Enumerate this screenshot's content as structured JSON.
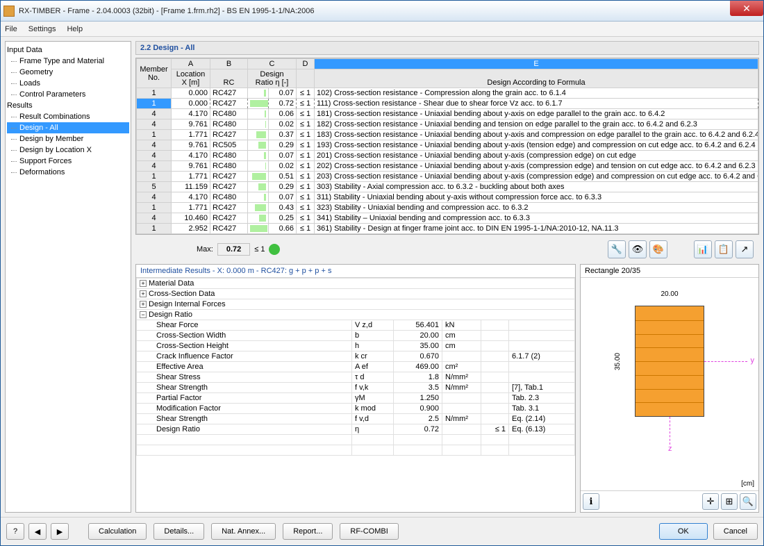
{
  "window": {
    "title": "RX-TIMBER - Frame - 2.04.0003 (32bit) - [Frame 1.frm.rh2] - BS EN 1995-1-1/NA:2006"
  },
  "menus": [
    "File",
    "Settings",
    "Help"
  ],
  "tree": {
    "input": "Input Data",
    "input_items": [
      "Frame Type and Material",
      "Geometry",
      "Loads",
      "Control Parameters"
    ],
    "results": "Results",
    "result_items": [
      "Result Combinations",
      "Design - All",
      "Design by Member",
      "Design by Location X",
      "Support Forces",
      "Deformations"
    ],
    "selected": "Design - All"
  },
  "section": "2.2 Design - All",
  "cols": {
    "letters": [
      "A",
      "B",
      "C",
      "D",
      "E"
    ],
    "member": "Member\nNo.",
    "loc": "Location\nX [m]",
    "rc": "RC",
    "design": "Design\nRatio η [-]",
    "acc": "Design According to Formula"
  },
  "rows": [
    {
      "m": "1",
      "x": "0.000",
      "rc": "RC427",
      "bar": 0.1,
      "r": "0.07",
      "c": "≤ 1",
      "d": "102) Cross-section resistance - Compression along the grain acc. to 6.1.4"
    },
    {
      "m": "1",
      "x": "0.000",
      "rc": "RC427",
      "bar": 0.95,
      "r": "0.72",
      "c": "≤ 1",
      "d": "111) Cross-section resistance - Shear due to shear force Vz acc. to 6.1.7",
      "sel": true
    },
    {
      "m": "4",
      "x": "4.170",
      "rc": "RC480",
      "bar": 0.08,
      "r": "0.06",
      "c": "≤ 1",
      "d": "181) Cross-section resistance - Uniaxial bending about y-axis on edge parallel to the grain acc. to 6.4.2"
    },
    {
      "m": "4",
      "x": "9.761",
      "rc": "RC480",
      "bar": 0.03,
      "r": "0.02",
      "c": "≤ 1",
      "d": "182) Cross-section resistance - Uniaxial bending and tension on edge parallel to the grain acc. to 6.4.2 and 6.2.3"
    },
    {
      "m": "1",
      "x": "1.771",
      "rc": "RC427",
      "bar": 0.5,
      "r": "0.37",
      "c": "≤ 1",
      "d": "183) Cross-section resistance - Uniaxial bending about y-axis and compression on edge parallel to the grain acc. to 6.4.2 and 6.2.4"
    },
    {
      "m": "4",
      "x": "9.761",
      "rc": "RC505",
      "bar": 0.4,
      "r": "0.29",
      "c": "≤ 1",
      "d": "193) Cross-section resistance - Uniaxial bending about y-axis (tension edge) and compression on cut edge acc. to 6.4.2 and 6.2.4"
    },
    {
      "m": "4",
      "x": "4.170",
      "rc": "RC480",
      "bar": 0.1,
      "r": "0.07",
      "c": "≤ 1",
      "d": "201) Cross-section resistance - Uniaxial bending about y-axis (compression edge) on cut edge"
    },
    {
      "m": "4",
      "x": "9.761",
      "rc": "RC480",
      "bar": 0.03,
      "r": "0.02",
      "c": "≤ 1",
      "d": "202) Cross-section resistance - Uniaxial bending about y-axis (compression edge) and tension on cut edge acc. to 6.4.2 and 6.2.3"
    },
    {
      "m": "1",
      "x": "1.771",
      "rc": "RC427",
      "bar": 0.7,
      "r": "0.51",
      "c": "≤ 1",
      "d": "203) Cross-section resistance - Uniaxial bending about y-axis (compression edge) and compression on cut edge acc. to 6.4.2 and 6."
    },
    {
      "m": "5",
      "x": "11.159",
      "rc": "RC427",
      "bar": 0.4,
      "r": "0.29",
      "c": "≤ 1",
      "d": "303) Stability - Axial compression acc. to 6.3.2 - buckling about both axes"
    },
    {
      "m": "4",
      "x": "4.170",
      "rc": "RC480",
      "bar": 0.1,
      "r": "0.07",
      "c": "≤ 1",
      "d": "311) Stability - Uniaxial bending about y-axis without compression force acc. to 6.3.3"
    },
    {
      "m": "1",
      "x": "1.771",
      "rc": "RC427",
      "bar": 0.58,
      "r": "0.43",
      "c": "≤ 1",
      "d": "323) Stability - Uniaxial bending and compression acc. to 6.3.2"
    },
    {
      "m": "4",
      "x": "10.460",
      "rc": "RC427",
      "bar": 0.34,
      "r": "0.25",
      "c": "≤ 1",
      "d": "341) Stability – Uniaxial bending and compression acc. to 6.3.3"
    },
    {
      "m": "1",
      "x": "2.952",
      "rc": "RC427",
      "bar": 0.88,
      "r": "0.66",
      "c": "≤ 1",
      "d": "361) Stability - Design at finger frame joint acc. to DIN EN 1995-1-1/NA:2010-12, NA.11.3"
    }
  ],
  "max": {
    "label": "Max:",
    "val": "0.72",
    "cond": "≤ 1"
  },
  "detail": {
    "title": "Intermediate Results  -  X: 0.000 m  -  RC427: g + p + p + s",
    "cats": [
      "Material Data",
      "Cross-Section Data",
      "Design Internal Forces",
      "Design Ratio"
    ],
    "rows": [
      {
        "n": "Shear Force",
        "s": "V z,d",
        "v": "56.401",
        "u": "kN",
        "cn": "",
        "ref": ""
      },
      {
        "n": "Cross-Section Width",
        "s": "b",
        "v": "20.00",
        "u": "cm",
        "cn": "",
        "ref": ""
      },
      {
        "n": "Cross-Section Height",
        "s": "h",
        "v": "35.00",
        "u": "cm",
        "cn": "",
        "ref": ""
      },
      {
        "n": "Crack Influence Factor",
        "s": "k cr",
        "v": "0.670",
        "u": "",
        "cn": "",
        "ref": "6.1.7 (2)"
      },
      {
        "n": "Effective Area",
        "s": "A ef",
        "v": "469.00",
        "u": "cm²",
        "cn": "",
        "ref": ""
      },
      {
        "n": "Shear Stress",
        "s": "τ d",
        "v": "1.8",
        "u": "N/mm²",
        "cn": "",
        "ref": ""
      },
      {
        "n": "Shear Strength",
        "s": "f v,k",
        "v": "3.5",
        "u": "N/mm²",
        "cn": "",
        "ref": "[7], Tab.1"
      },
      {
        "n": "Partial Factor",
        "s": "γM",
        "v": "1.250",
        "u": "",
        "cn": "",
        "ref": "Tab. 2.3"
      },
      {
        "n": "Modification Factor",
        "s": "k mod",
        "v": "0.900",
        "u": "",
        "cn": "",
        "ref": "Tab. 3.1"
      },
      {
        "n": "Shear Strength",
        "s": "f v,d",
        "v": "2.5",
        "u": "N/mm²",
        "cn": "",
        "ref": "Eq. (2.14)"
      },
      {
        "n": "Design Ratio",
        "s": "η",
        "v": "0.72",
        "u": "",
        "cn": "≤ 1",
        "ref": "Eq. (6.13)"
      }
    ]
  },
  "cs": {
    "title": "Rectangle 20/35",
    "w": "20.00",
    "h": "35.00",
    "unit": "[cm]"
  },
  "footer": {
    "calc": "Calculation",
    "details": "Details...",
    "annex": "Nat. Annex...",
    "report": "Report...",
    "combi": "RF-COMBI",
    "ok": "OK",
    "cancel": "Cancel"
  }
}
